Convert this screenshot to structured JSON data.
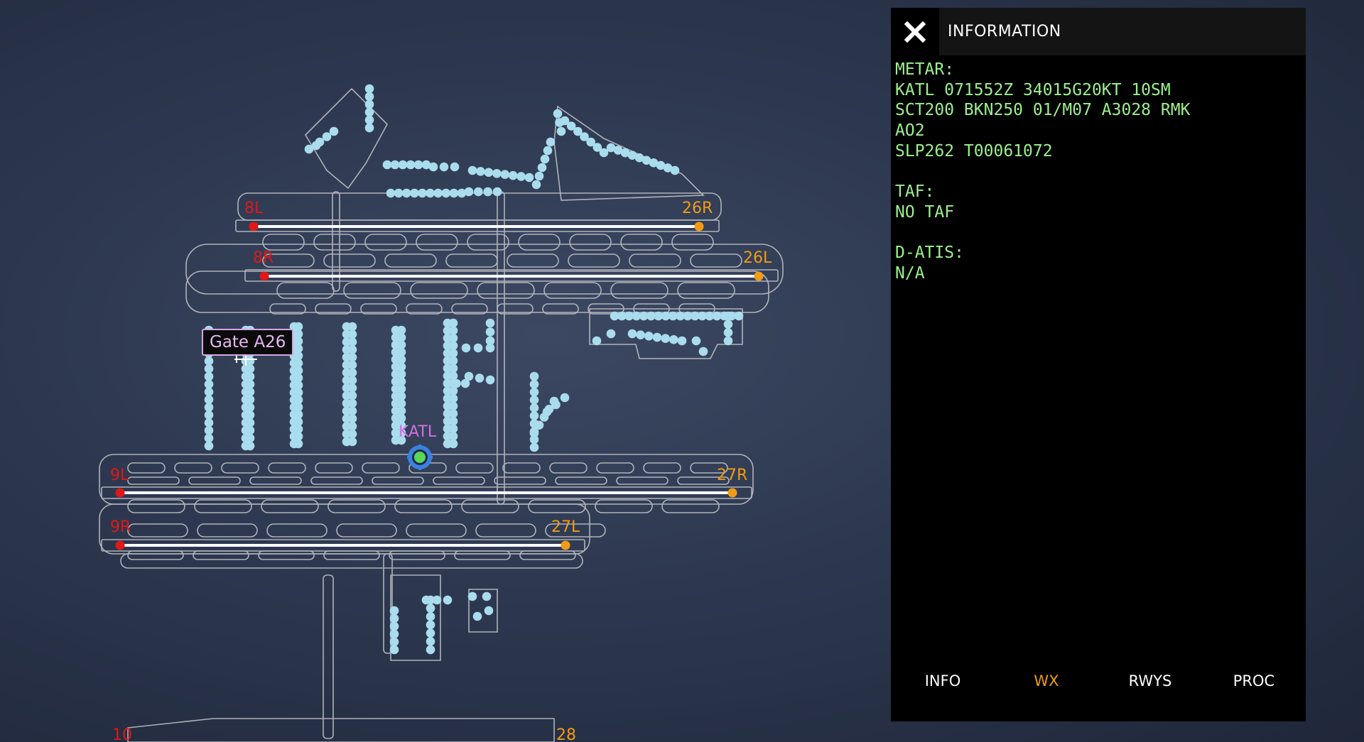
{
  "map": {
    "gate_label": "Gate A26",
    "airport_label": "KATL",
    "runway_labels": [
      "8L",
      "26R",
      "8R",
      "26L",
      "9L",
      "27R",
      "9R",
      "27L",
      "10",
      "28"
    ],
    "colors": {
      "runway_start": "#e01818",
      "runway_end": "#f29b14",
      "gates": "#a9dcec",
      "taxiway": "#c8c8c8",
      "airport_marker": "#3b82e0"
    }
  },
  "panel": {
    "title": "INFORMATION",
    "close_icon": "close-icon",
    "lines": [
      "METAR:",
      "KATL 071552Z 34015G20KT 10SM",
      "SCT200 BKN250 01/M07 A3028 RMK",
      "AO2",
      "SLP262 T00061072",
      "",
      "TAF:",
      "NO TAF",
      "",
      "D-ATIS:",
      "N/A"
    ],
    "tabs": [
      {
        "label": "INFO",
        "active": false
      },
      {
        "label": "WX",
        "active": true
      },
      {
        "label": "RWYS",
        "active": false
      },
      {
        "label": "PROC",
        "active": false
      }
    ],
    "colors": {
      "text": "#9cf08e",
      "active_tab": "#f29b14"
    }
  }
}
